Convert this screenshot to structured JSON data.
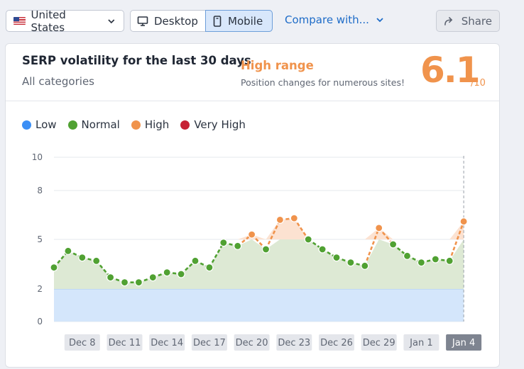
{
  "toolbar": {
    "country": "United States",
    "desktop_label": "Desktop",
    "mobile_label": "Mobile",
    "compare_label": "Compare with...",
    "share_label": "Share"
  },
  "card": {
    "title": "SERP volatility for the last 30 days",
    "subtitle": "All categories",
    "range_label": "High range",
    "range_desc": "Position changes for numerous sites!",
    "score": "6.1",
    "score_den": "/10"
  },
  "colors": {
    "low": "#3b8ff5",
    "normal": "#50a132",
    "high": "#f0934c",
    "very_high": "#c72134"
  },
  "legend": [
    {
      "label": "Low",
      "color": "#3b8ff5"
    },
    {
      "label": "Normal",
      "color": "#50a132"
    },
    {
      "label": "High",
      "color": "#f0934c"
    },
    {
      "label": "Very High",
      "color": "#c72134"
    }
  ],
  "chart_data": {
    "type": "line",
    "y_ticks": [
      0,
      2,
      5,
      8,
      10
    ],
    "x_labels": [
      "Dec 8",
      "Dec 11",
      "Dec 14",
      "Dec 17",
      "Dec 20",
      "Dec 23",
      "Dec 26",
      "Dec 29",
      "Jan 1",
      "Jan 4"
    ],
    "active_label": "Jan 4",
    "low_band": [
      0,
      2
    ],
    "high_threshold": 5,
    "series": [
      {
        "values": [
          3.3,
          4.3,
          3.9,
          3.7,
          2.7,
          2.4,
          2.4,
          2.7,
          3.0,
          2.9,
          3.7,
          3.3,
          4.8,
          4.6,
          5.3,
          4.4,
          6.2,
          6.3,
          5.0,
          4.4,
          3.9,
          3.6,
          3.4,
          5.7,
          4.7,
          4.0,
          3.6,
          3.8,
          3.7,
          6.1
        ]
      }
    ]
  }
}
